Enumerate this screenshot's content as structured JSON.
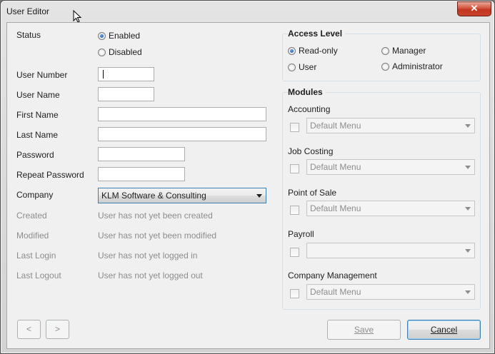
{
  "window": {
    "title": "User Editor",
    "close_glyph": "✕"
  },
  "status": {
    "label": "Status",
    "options": [
      {
        "label": "Enabled",
        "selected": true
      },
      {
        "label": "Disabled",
        "selected": false
      }
    ]
  },
  "fields": {
    "user_number": {
      "label": "User Number",
      "value": ""
    },
    "user_name": {
      "label": "User Name",
      "value": ""
    },
    "first_name": {
      "label": "First Name",
      "value": ""
    },
    "last_name": {
      "label": "Last Name",
      "value": ""
    },
    "password": {
      "label": "Password",
      "value": ""
    },
    "repeat_password": {
      "label": "Repeat Password",
      "value": ""
    },
    "company": {
      "label": "Company",
      "value": "KLM Software & Consulting"
    }
  },
  "info": {
    "created": {
      "label": "Created",
      "value": "User has not yet been created"
    },
    "modified": {
      "label": "Modified",
      "value": "User has not yet been modified"
    },
    "last_login": {
      "label": "Last Login",
      "value": "User has not yet logged in"
    },
    "last_logout": {
      "label": "Last Logout",
      "value": "User has not yet logged out"
    }
  },
  "access_level": {
    "title": "Access Level",
    "options": [
      {
        "label": "Read-only",
        "selected": true
      },
      {
        "label": "Manager",
        "selected": false
      },
      {
        "label": "User",
        "selected": false
      },
      {
        "label": "Administrator",
        "selected": false
      }
    ]
  },
  "modules": {
    "title": "Modules",
    "items": [
      {
        "label": "Accounting",
        "checked": false,
        "menu": "Default Menu"
      },
      {
        "label": "Job Costing",
        "checked": false,
        "menu": "Default Menu"
      },
      {
        "label": "Point of Sale",
        "checked": false,
        "menu": "Default Menu"
      },
      {
        "label": "Payroll",
        "checked": false,
        "menu": ""
      },
      {
        "label": "Company Management",
        "checked": false,
        "menu": "Default Menu"
      }
    ]
  },
  "nav": {
    "prev": "<",
    "next": ">"
  },
  "buttons": {
    "save": "Save",
    "cancel": "Cancel"
  },
  "colors": {
    "accent": "#1d4f9a",
    "close": "#c8452e",
    "disabled_text": "#8d8d8d"
  }
}
